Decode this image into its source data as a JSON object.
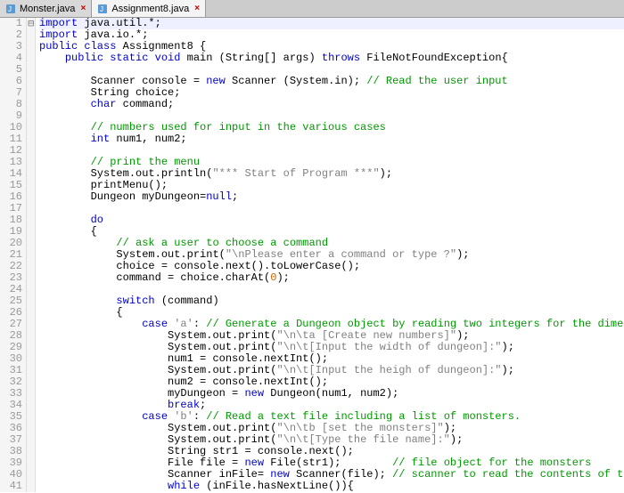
{
  "tabs": [
    {
      "label": "Monster.java",
      "active": false
    },
    {
      "label": "Assignment8.java",
      "active": true
    }
  ],
  "fold_markers": {
    "3": "⊟",
    "4": "⊟",
    "19": "⊟",
    "27": "⊟"
  },
  "code_lines": [
    {
      "n": 1,
      "ind": 0,
      "hl": true,
      "tokens": [
        [
          "kw",
          "import"
        ],
        [
          "pl",
          " java.util.*;"
        ]
      ]
    },
    {
      "n": 2,
      "ind": 0,
      "tokens": [
        [
          "kw",
          "import"
        ],
        [
          "pl",
          " java.io.*;"
        ]
      ]
    },
    {
      "n": 3,
      "ind": 0,
      "tokens": [
        [
          "kw",
          "public class"
        ],
        [
          "pl",
          " Assignment8 {"
        ]
      ]
    },
    {
      "n": 4,
      "ind": 1,
      "tokens": [
        [
          "kw",
          "public static void"
        ],
        [
          "pl",
          " main (String[] args) "
        ],
        [
          "kw",
          "throws"
        ],
        [
          "pl",
          " FileNotFoundException{"
        ]
      ]
    },
    {
      "n": 5,
      "ind": 0,
      "tokens": []
    },
    {
      "n": 6,
      "ind": 2,
      "tokens": [
        [
          "pl",
          "Scanner console = "
        ],
        [
          "kw",
          "new"
        ],
        [
          "pl",
          " Scanner (System.in); "
        ],
        [
          "cm",
          "// Read the user input"
        ]
      ]
    },
    {
      "n": 7,
      "ind": 2,
      "tokens": [
        [
          "pl",
          "String choice;"
        ]
      ]
    },
    {
      "n": 8,
      "ind": 2,
      "tokens": [
        [
          "kw",
          "char"
        ],
        [
          "pl",
          " command;"
        ]
      ]
    },
    {
      "n": 9,
      "ind": 0,
      "tokens": []
    },
    {
      "n": 10,
      "ind": 2,
      "tokens": [
        [
          "cm",
          "// numbers used for input in the various cases"
        ]
      ]
    },
    {
      "n": 11,
      "ind": 2,
      "tokens": [
        [
          "kw",
          "int"
        ],
        [
          "pl",
          " num1, num2;"
        ]
      ]
    },
    {
      "n": 12,
      "ind": 0,
      "tokens": []
    },
    {
      "n": 13,
      "ind": 2,
      "tokens": [
        [
          "cm",
          "// print the menu"
        ]
      ]
    },
    {
      "n": 14,
      "ind": 2,
      "tokens": [
        [
          "pl",
          "System.out.println("
        ],
        [
          "st",
          "\"*** Start of Program ***\""
        ],
        [
          "pl",
          ");"
        ]
      ]
    },
    {
      "n": 15,
      "ind": 2,
      "tokens": [
        [
          "pl",
          "printMenu();"
        ]
      ]
    },
    {
      "n": 16,
      "ind": 2,
      "tokens": [
        [
          "pl",
          "Dungeon myDungeon="
        ],
        [
          "kw",
          "null"
        ],
        [
          "pl",
          ";"
        ]
      ]
    },
    {
      "n": 17,
      "ind": 0,
      "tokens": []
    },
    {
      "n": 18,
      "ind": 2,
      "tokens": [
        [
          "kw",
          "do"
        ]
      ]
    },
    {
      "n": 19,
      "ind": 2,
      "tokens": [
        [
          "pl",
          "{"
        ]
      ]
    },
    {
      "n": 20,
      "ind": 3,
      "tokens": [
        [
          "cm",
          "// ask a user to choose a command"
        ]
      ]
    },
    {
      "n": 21,
      "ind": 3,
      "tokens": [
        [
          "pl",
          "System.out.print("
        ],
        [
          "st",
          "\"\\nPlease enter a command or type ?\""
        ],
        [
          "pl",
          ");"
        ]
      ]
    },
    {
      "n": 22,
      "ind": 3,
      "tokens": [
        [
          "pl",
          "choice = console.next().toLowerCase();"
        ]
      ]
    },
    {
      "n": 23,
      "ind": 3,
      "tokens": [
        [
          "pl",
          "command = choice.charAt("
        ],
        [
          "nm",
          "0"
        ],
        [
          "pl",
          ");"
        ]
      ]
    },
    {
      "n": 24,
      "ind": 0,
      "tokens": []
    },
    {
      "n": 25,
      "ind": 3,
      "tokens": [
        [
          "kw",
          "switch"
        ],
        [
          "pl",
          " (command)"
        ]
      ]
    },
    {
      "n": 26,
      "ind": 3,
      "tokens": [
        [
          "pl",
          "{"
        ]
      ]
    },
    {
      "n": 27,
      "ind": 4,
      "tokens": [
        [
          "kw",
          "case"
        ],
        [
          "pl",
          " "
        ],
        [
          "st",
          "'a'"
        ],
        [
          "pl",
          ": "
        ],
        [
          "cm",
          "// Generate a Dungeon object by reading two integers for the dimension"
        ]
      ]
    },
    {
      "n": 28,
      "ind": 5,
      "tokens": [
        [
          "pl",
          "System.out.print("
        ],
        [
          "st",
          "\"\\n\\ta [Create new numbers]\""
        ],
        [
          "pl",
          ");"
        ]
      ]
    },
    {
      "n": 29,
      "ind": 5,
      "tokens": [
        [
          "pl",
          "System.out.print("
        ],
        [
          "st",
          "\"\\n\\t[Input the width of dungeon]:\""
        ],
        [
          "pl",
          ");"
        ]
      ]
    },
    {
      "n": 30,
      "ind": 5,
      "tokens": [
        [
          "pl",
          "num1 = console.nextInt();"
        ]
      ]
    },
    {
      "n": 31,
      "ind": 5,
      "tokens": [
        [
          "pl",
          "System.out.print("
        ],
        [
          "st",
          "\"\\n\\t[Input the heigh of dungeon]:\""
        ],
        [
          "pl",
          ");"
        ]
      ]
    },
    {
      "n": 32,
      "ind": 5,
      "tokens": [
        [
          "pl",
          "num2 = console.nextInt();"
        ]
      ]
    },
    {
      "n": 33,
      "ind": 5,
      "tokens": [
        [
          "pl",
          "myDungeon = "
        ],
        [
          "kw",
          "new"
        ],
        [
          "pl",
          " Dungeon(num1, num2);"
        ]
      ]
    },
    {
      "n": 34,
      "ind": 5,
      "tokens": [
        [
          "kw",
          "break"
        ],
        [
          "pl",
          ";"
        ]
      ]
    },
    {
      "n": 35,
      "ind": 4,
      "tokens": [
        [
          "kw",
          "case"
        ],
        [
          "pl",
          " "
        ],
        [
          "st",
          "'b'"
        ],
        [
          "pl",
          ": "
        ],
        [
          "cm",
          "// Read a text file including a list of monsters."
        ]
      ]
    },
    {
      "n": 36,
      "ind": 5,
      "tokens": [
        [
          "pl",
          "System.out.print("
        ],
        [
          "st",
          "\"\\n\\tb [set the monsters]\""
        ],
        [
          "pl",
          ");"
        ]
      ]
    },
    {
      "n": 37,
      "ind": 5,
      "tokens": [
        [
          "pl",
          "System.out.print("
        ],
        [
          "st",
          "\"\\n\\t[Type the file name]:\""
        ],
        [
          "pl",
          ");"
        ]
      ]
    },
    {
      "n": 38,
      "ind": 5,
      "tokens": [
        [
          "pl",
          "String str1 = console.next();"
        ]
      ]
    },
    {
      "n": 39,
      "ind": 5,
      "tokens": [
        [
          "pl",
          "File file = "
        ],
        [
          "kw",
          "new"
        ],
        [
          "pl",
          " File(str1);        "
        ],
        [
          "cm",
          "// file object for the monsters"
        ]
      ]
    },
    {
      "n": 40,
      "ind": 5,
      "tokens": [
        [
          "pl",
          "Scanner inFile= "
        ],
        [
          "kw",
          "new"
        ],
        [
          "pl",
          " Scanner(file); "
        ],
        [
          "cm",
          "// scanner to read the contents of text file"
        ]
      ]
    },
    {
      "n": 41,
      "ind": 5,
      "tokens": [
        [
          "kw",
          "while"
        ],
        [
          "pl",
          " (inFile.hasNextLine()){"
        ]
      ]
    }
  ],
  "indent_unit": "    "
}
